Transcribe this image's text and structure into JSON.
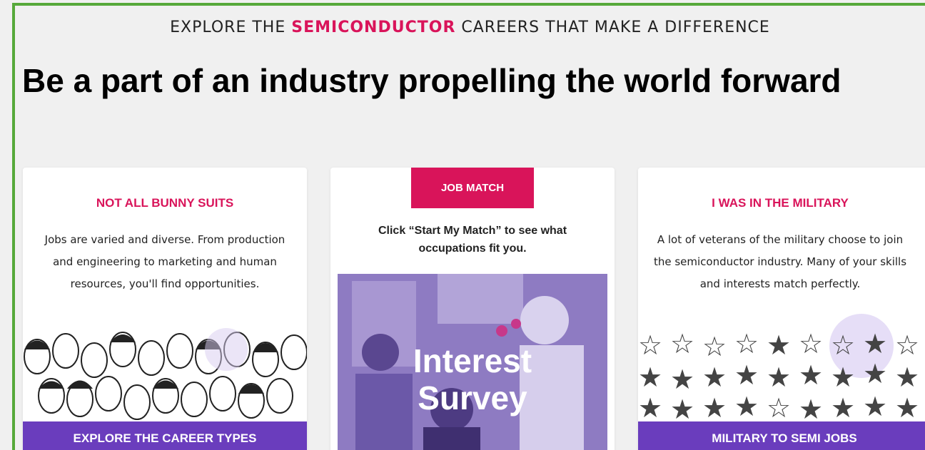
{
  "header": {
    "eyebrow_before": "EXPLORE THE ",
    "eyebrow_accent": "SEMICONDUCTOR",
    "eyebrow_after": " CAREERS THAT MAKE A DIFFERENCE",
    "headline": "Be a part of an industry propelling the world forward"
  },
  "cards": [
    {
      "title": "NOT ALL BUNNY SUITS",
      "body": "Jobs are varied and diverse. From production and engineering to marketing and human resources, you'll find opportunities.",
      "cta": "EXPLORE THE CAREER TYPES"
    },
    {
      "tab": "JOB MATCH",
      "body": "Click “Start My Match” to see what occupations fit you.",
      "image_label_line1": "Interest",
      "image_label_line2": "Survey"
    },
    {
      "title": "I WAS IN THE MILITARY",
      "body": "A lot of veterans of the military choose to join the semiconductor industry. Many of your skills and interests match perfectly.",
      "cta": "MILITARY TO SEMI JOBS"
    }
  ],
  "colors": {
    "accent": "#d9145a",
    "purple": "#6a3dbd",
    "frame": "#56a93a"
  }
}
